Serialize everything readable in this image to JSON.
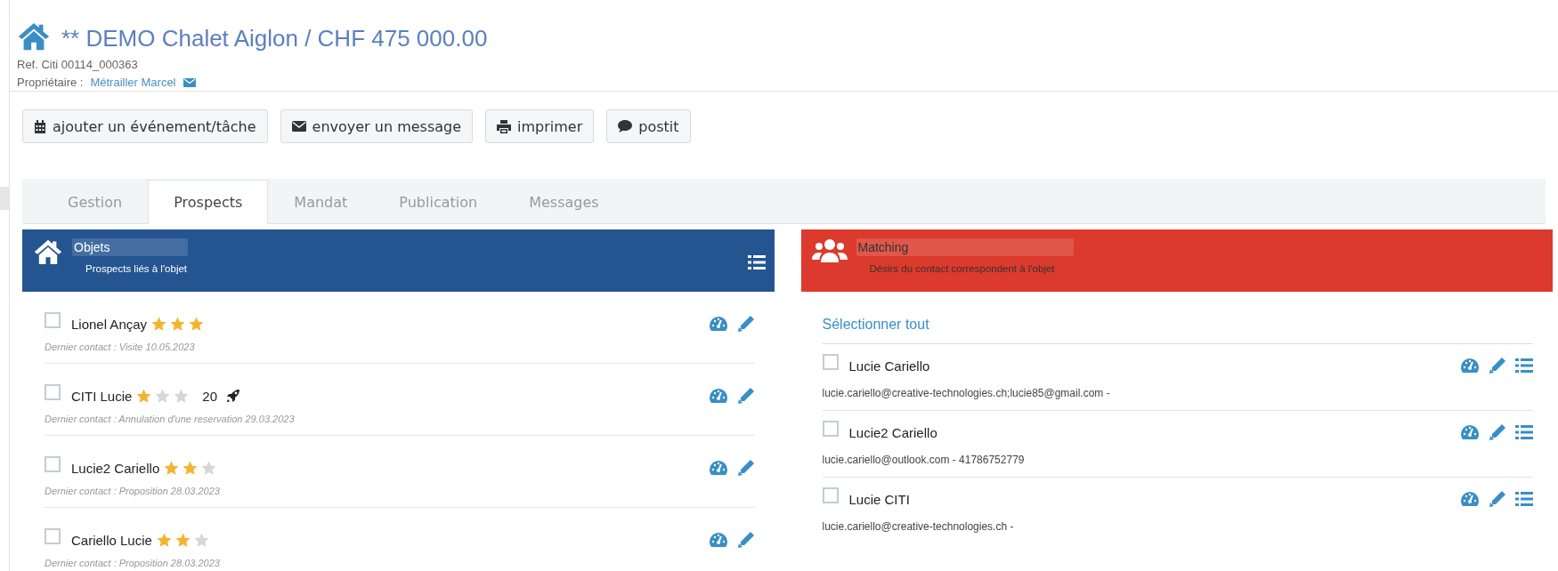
{
  "header": {
    "title": "** DEMO Chalet Aiglon / CHF 475 000.00",
    "reference": "Ref. Citi 00114_000363",
    "owner_label": "Propriétaire :",
    "owner_name": "Métrailler Marcel"
  },
  "actions": [
    {
      "label": "ajouter un événement/tâche",
      "kind": "calendar"
    },
    {
      "label": "envoyer un message",
      "kind": "envelope"
    },
    {
      "label": "imprimer",
      "kind": "print"
    },
    {
      "label": "postit",
      "kind": "comment"
    }
  ],
  "tabs": [
    {
      "label": "Gestion",
      "selected": false
    },
    {
      "label": "Prospects",
      "selected": true
    },
    {
      "label": "Mandat",
      "selected": false
    },
    {
      "label": "Publication",
      "selected": false
    },
    {
      "label": "Messages",
      "selected": false
    }
  ],
  "objects_panel": {
    "title": "Objets",
    "subtitle": "Prospects liés à l'objet",
    "prospects": [
      {
        "name": "Lionel Ançay",
        "checked": false,
        "stars": 3,
        "detail": "Dernier contact : Visite 10.05.2023"
      },
      {
        "name": "CITI Lucie",
        "checked": false,
        "stars": 1,
        "score": "20",
        "detail": "Dernier contact : Annulation d'une reservation 29.03.2023"
      },
      {
        "name": "Lucie2 Cariello",
        "checked": false,
        "stars": 2,
        "detail": "Dernier contact : Proposition 28.03.2023"
      },
      {
        "name": "Cariello Lucie",
        "checked": false,
        "stars": 2,
        "detail": "Dernier contact : Proposition 28.03.2023"
      }
    ]
  },
  "matching_panel": {
    "title": "Matching",
    "subtitle": "Désirs du contact correspondent à l'objet",
    "select_all": "Sélectionner tout",
    "contacts": [
      {
        "name": "Lucie Cariello",
        "checked": false,
        "detail": "lucie.cariello@creative-technologies.ch;lucie85@gmail.com -"
      },
      {
        "name": "Lucie2 Cariello",
        "checked": false,
        "detail": "lucie.cariello@outlook.com - 41786752779"
      },
      {
        "name": "Lucie CITI",
        "checked": false,
        "detail": "lucie.cariello@creative-technologies.ch -"
      }
    ]
  }
}
